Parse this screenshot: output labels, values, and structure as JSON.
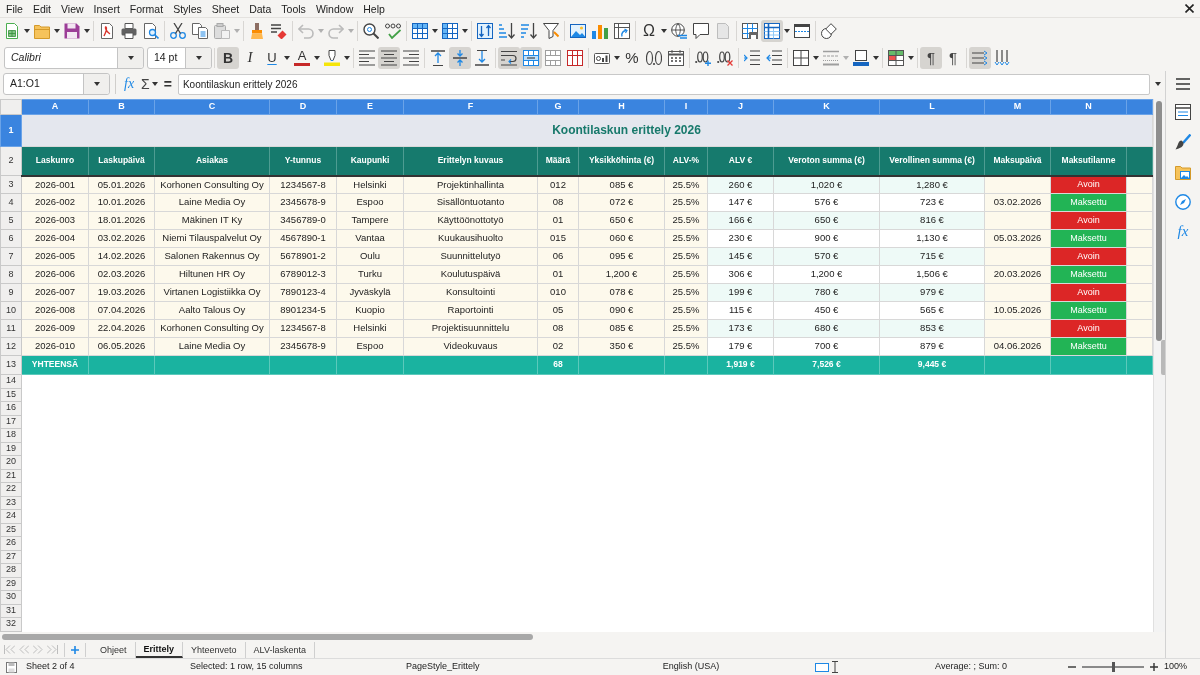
{
  "menu_bar": [
    "File",
    "Edit",
    "View",
    "Insert",
    "Format",
    "Styles",
    "Sheet",
    "Data",
    "Tools",
    "Window",
    "Help"
  ],
  "standard_toolbar": {
    "special_character": "Ω",
    "freeze_rows_and_columns": {
      "pressed": true
    }
  },
  "formatting_toolbar": {
    "font_name": "Calibri",
    "font_size": "14 pt",
    "bold": {
      "glyph": "B",
      "pressed": true
    },
    "italic": {
      "glyph": "I",
      "pressed": false
    },
    "underline": {
      "glyph": "U",
      "pressed": false
    },
    "font_color": {
      "glyph": "A"
    },
    "horizontal_align": [
      {
        "selected": false
      },
      {
        "selected": true
      },
      {
        "selected": false
      }
    ],
    "vertical_align": [
      {
        "selected": false
      },
      {
        "selected": true
      },
      {
        "selected": false
      }
    ],
    "wrap_text": {
      "pressed": true
    },
    "merge_and_center": {
      "pressed": true
    },
    "percent": "%",
    "paragraph_direction": [
      {
        "glyph": "¶",
        "selected": true
      },
      {
        "glyph": "¶",
        "selected": false
      }
    ],
    "text_direction": [
      {
        "selected": true
      },
      {
        "selected": false
      }
    ]
  },
  "formula_bar": {
    "name_box": "A1:O1",
    "function_wizard": "fx",
    "sum": "Σ",
    "equals": "=",
    "content": "Koontilaskun erittely 2026"
  },
  "sheet": {
    "column_letters": [
      "A",
      "B",
      "C",
      "D",
      "E",
      "F",
      "G",
      "H",
      "I",
      "J",
      "K",
      "L",
      "M",
      "N"
    ],
    "row_numbers": [
      "1",
      "2",
      "3",
      "4",
      "5",
      "6",
      "7",
      "8",
      "9",
      "10",
      "11",
      "12",
      "13",
      "14",
      "15",
      "16",
      "17",
      "18",
      "19",
      "20",
      "21",
      "22",
      "23",
      "24",
      "25",
      "26",
      "27",
      "28",
      "29",
      "30",
      "31",
      "32"
    ],
    "title": "Koontilaskun erittely 2026",
    "headers": [
      "Laskunro",
      "Laskupäivä",
      "Asiakas",
      "Y-tunnus",
      "Kaupunki",
      "Erittelyn kuvaus",
      "Määrä",
      "Yksikköhinta (€)",
      "ALV-%",
      "ALV €",
      "Veroton summa (€)",
      "Verollinen summa (€)",
      "Maksupäivä",
      "Maksutilanne"
    ],
    "rows": [
      {
        "number": "2026-001",
        "date": "05.01.2026",
        "customer": "Korhonen Consulting Oy",
        "business_id": "1234567-8",
        "city": "Helsinki",
        "description": "Projektinhallinta",
        "quantity": "012",
        "unit_price": "085 €",
        "vat_rate": "25.5%",
        "vat": "260 €",
        "net": "1,020 €",
        "gross": "1,280 €",
        "status": {
          "text": "Avoin",
          "color": "#dc2626"
        }
      },
      {
        "number": "2026-002",
        "date": "10.01.2026",
        "customer": "Laine Media Oy",
        "business_id": "2345678-9",
        "city": "Espoo",
        "description": "Sisällöntuotanto",
        "quantity": "08",
        "unit_price": "072 €",
        "vat_rate": "25.5%",
        "vat": "147 €",
        "net": "576 €",
        "gross": "723 €",
        "paid_on": "03.02.2026",
        "status": {
          "text": "Maksettu",
          "color": "#22b455"
        }
      },
      {
        "number": "2026-003",
        "date": "18.01.2026",
        "customer": "Mäkinen IT Ky",
        "business_id": "3456789-0",
        "city": "Tampere",
        "description": "Käyttöönottotyö",
        "quantity": "01",
        "unit_price": "650 €",
        "vat_rate": "25.5%",
        "vat": "166 €",
        "net": "650 €",
        "gross": "816 €",
        "status": {
          "text": "Avoin",
          "color": "#dc2626"
        }
      },
      {
        "number": "2026-004",
        "date": "03.02.2026",
        "customer": "Niemi Tilauspalvelut Oy",
        "business_id": "4567890-1",
        "city": "Vantaa",
        "description": "Kuukausihuolto",
        "quantity": "015",
        "unit_price": "060 €",
        "vat_rate": "25.5%",
        "vat": "230 €",
        "net": "900 €",
        "gross": "1,130 €",
        "paid_on": "05.03.2026",
        "status": {
          "text": "Maksettu",
          "color": "#22b455"
        }
      },
      {
        "number": "2026-005",
        "date": "14.02.2026",
        "customer": "Salonen Rakennus Oy",
        "business_id": "5678901-2",
        "city": "Oulu",
        "description": "Suunnittelutyö",
        "quantity": "06",
        "unit_price": "095 €",
        "vat_rate": "25.5%",
        "vat": "145 €",
        "net": "570 €",
        "gross": "715 €",
        "status": {
          "text": "Avoin",
          "color": "#dc2626"
        }
      },
      {
        "number": "2026-006",
        "date": "02.03.2026",
        "customer": "Hiltunen HR Oy",
        "business_id": "6789012-3",
        "city": "Turku",
        "description": "Koulutuspäivä",
        "quantity": "01",
        "unit_price": "1,200 €",
        "vat_rate": "25.5%",
        "vat": "306 €",
        "net": "1,200 €",
        "gross": "1,506 €",
        "paid_on": "20.03.2026",
        "status": {
          "text": "Maksettu",
          "color": "#22b455"
        }
      },
      {
        "number": "2026-007",
        "date": "19.03.2026",
        "customer": "Virtanen Logistiikka Oy",
        "business_id": "7890123-4",
        "city": "Jyväskylä",
        "description": "Konsultointi",
        "quantity": "010",
        "unit_price": "078 €",
        "vat_rate": "25.5%",
        "vat": "199 €",
        "net": "780 €",
        "gross": "979 €",
        "status": {
          "text": "Avoin",
          "color": "#dc2626"
        }
      },
      {
        "number": "2026-008",
        "date": "07.04.2026",
        "customer": "Aalto Talous Oy",
        "business_id": "8901234-5",
        "city": "Kuopio",
        "description": "Raportointi",
        "quantity": "05",
        "unit_price": "090 €",
        "vat_rate": "25.5%",
        "vat": "115 €",
        "net": "450 €",
        "gross": "565 €",
        "paid_on": "10.05.2026",
        "status": {
          "text": "Maksettu",
          "color": "#22b455"
        }
      },
      {
        "number": "2026-009",
        "date": "22.04.2026",
        "customer": "Korhonen Consulting Oy",
        "business_id": "1234567-8",
        "city": "Helsinki",
        "description": "Projektisuunnittelu",
        "quantity": "08",
        "unit_price": "085 €",
        "vat_rate": "25.5%",
        "vat": "173 €",
        "net": "680 €",
        "gross": "853 €",
        "status": {
          "text": "Avoin",
          "color": "#dc2626"
        }
      },
      {
        "number": "2026-010",
        "date": "06.05.2026",
        "customer": "Laine Media Oy",
        "business_id": "2345678-9",
        "city": "Espoo",
        "description": "Videokuvaus",
        "quantity": "02",
        "unit_price": "350 €",
        "vat_rate": "25.5%",
        "vat": "179 €",
        "net": "700 €",
        "gross": "879 €",
        "paid_on": "04.06.2026",
        "status": {
          "text": "Maksettu",
          "color": "#22b455"
        }
      }
    ],
    "totals": {
      "label": "YHTEENSÄ",
      "quantity": "68",
      "vat": "1,919 €",
      "net": "7,526 €",
      "gross": "9,445 €"
    }
  },
  "sidebar": {
    "functions": "fx"
  },
  "sheet_tabs": [
    {
      "label": "Ohjeet",
      "selected": false
    },
    {
      "label": "Erittely",
      "selected": true
    },
    {
      "label": "Yhteenveto",
      "selected": false
    },
    {
      "label": "ALV-laskenta",
      "selected": false
    }
  ],
  "status_bar": {
    "sheet": "Sheet 2 of 4",
    "selection": "Selected: 1 row, 15 columns",
    "page_style": "PageStyle_Erittely",
    "language": "English (USA)",
    "summary": "Average: ; Sum: 0",
    "zoom": {
      "level": 0.5,
      "reading": "100%"
    }
  }
}
